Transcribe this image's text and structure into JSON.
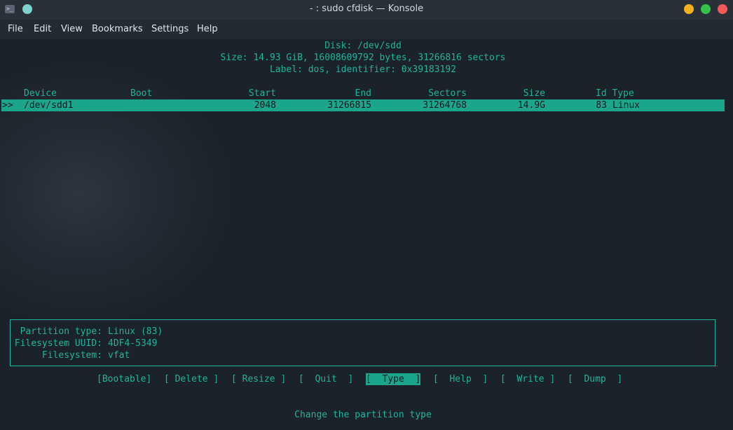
{
  "window": {
    "title": "- : sudo cfdisk — Konsole",
    "app_icon_glyph": ">_",
    "colors": {
      "minimize": "#f6b11e",
      "maximize": "#35c24a",
      "close": "#f25a5a",
      "accent": "#1fb49b"
    }
  },
  "menu": {
    "file": "File",
    "edit": "Edit",
    "view": "View",
    "bookmarks": "Bookmarks",
    "settings": "Settings",
    "help": "Help"
  },
  "disk": {
    "line1": "Disk: /dev/sdd",
    "line2": "Size: 14.93 GiB, 16008609792 bytes, 31266816 sectors",
    "line3": "Label: dos, identifier: 0x39183192"
  },
  "table": {
    "headers": {
      "device": "Device",
      "boot": "Boot",
      "start": "Start",
      "end": "End",
      "sectors": "Sectors",
      "size": "Size",
      "id_type": "Id Type"
    },
    "rows": [
      {
        "marker": ">>",
        "device": "/dev/sdd1",
        "boot": "",
        "start": "2048",
        "end": "31266815",
        "sectors": "31264768",
        "size": "14.9G",
        "id": "83",
        "type": "Linux",
        "selected": true
      }
    ]
  },
  "info": {
    "partition_type_label": "Partition type:",
    "partition_type_value": "Linux (83)",
    "uuid_label": "Filesystem UUID:",
    "uuid_value": "4DF4-5349",
    "fs_label": "Filesystem:",
    "fs_value": "vfat"
  },
  "actions": {
    "bootable": "[Bootable]",
    "delete": "[ Delete ]",
    "resize": "[ Resize ]",
    "quit": "[  Quit  ]",
    "type": "[  Type  ]",
    "help": "[  Help  ]",
    "write": "[  Write ]",
    "dump": "[  Dump  ]",
    "selected": "type"
  },
  "status": "Change the partition type"
}
